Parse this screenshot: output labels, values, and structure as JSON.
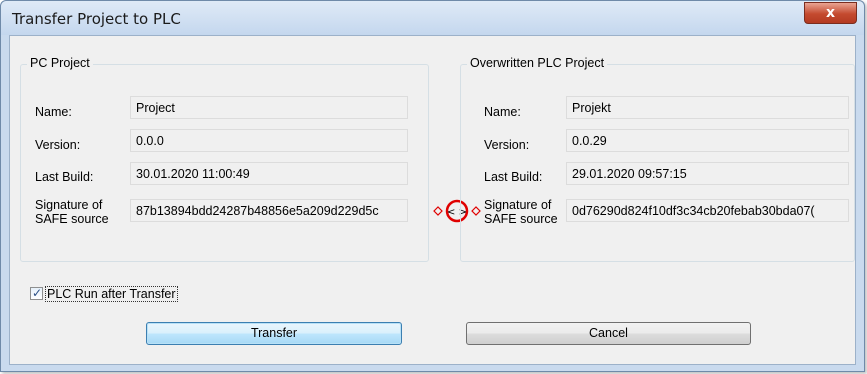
{
  "window": {
    "title": "Transfer Project to PLC",
    "close_label": "x"
  },
  "pc_project": {
    "group_title": "PC Project",
    "name_label": "Name:",
    "name_value": "Project",
    "version_label": "Version:",
    "version_value": "0.0.0",
    "last_build_label": "Last Build:",
    "last_build_value": "30.01.2020 11:00:49",
    "signature_label_line1": "Signature of",
    "signature_label_line2": "SAFE source",
    "signature_value": "87b13894bdd24287b48856e5a209d229d5c"
  },
  "plc_project": {
    "group_title": "Overwritten PLC Project",
    "name_label": "Name:",
    "name_value": "Projekt",
    "version_label": "Version:",
    "version_value": "0.0.29",
    "last_build_label": "Last Build:",
    "last_build_value": "29.01.2020 09:57:15",
    "signature_label_line1": "Signature of",
    "signature_label_line2": "SAFE source",
    "signature_value": "0d76290d824f10df3c34cb20febab30bda07("
  },
  "compare_icon": {
    "glyph": "< >",
    "color": "#e00000"
  },
  "options": {
    "plc_run_label": "PLC Run after Transfer",
    "plc_run_checked": true,
    "check_glyph": "✓"
  },
  "buttons": {
    "transfer_label": "Transfer",
    "cancel_label": "Cancel"
  }
}
